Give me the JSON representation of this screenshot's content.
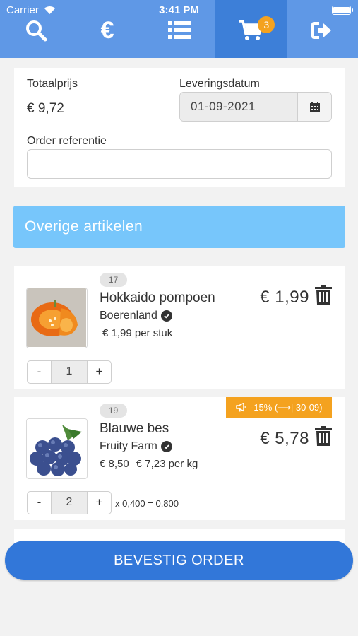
{
  "status_bar": {
    "carrier": "Carrier",
    "time": "3:41 PM"
  },
  "nav": {
    "tabs": [
      {
        "icon": "search-icon",
        "active": false
      },
      {
        "icon": "euro-icon",
        "glyph": "€",
        "active": false
      },
      {
        "icon": "list-icon",
        "active": false
      },
      {
        "icon": "cart-icon",
        "active": true,
        "badge": "3"
      },
      {
        "icon": "logout-icon",
        "active": false
      }
    ]
  },
  "order": {
    "total_label": "Totaalprijs",
    "total_value": "€ 9,72",
    "delivery_label": "Leveringsdatum",
    "delivery_value": "01-09-2021",
    "reference_label": "Order referentie",
    "reference_value": ""
  },
  "section": {
    "title": "Overige artikelen"
  },
  "items": [
    {
      "position": "17",
      "name": "Hokkaido pompoen",
      "brand": "Boerenland",
      "unit_price": "€ 1,99 per stuk",
      "old_price": "",
      "price": "€ 1,99",
      "quantity": "1",
      "calc": "",
      "promo": ""
    },
    {
      "position": "19",
      "name": "Blauwe bes",
      "brand": "Fruity Farm",
      "old_price": "€ 8,50",
      "unit_price": "€ 7,23 per kg",
      "price": "€ 5,78",
      "quantity": "2",
      "calc": "x 0,400 = 0,800",
      "promo": "-15% (⟶| 30-09)"
    }
  ],
  "qty_buttons": {
    "minus": "-",
    "plus": "+"
  },
  "confirm_button": "BEVESTIG ORDER",
  "colors": {
    "nav_bg": "#5f98e6",
    "nav_active": "#3d7fd8",
    "badge": "#f4a21f",
    "section_bar": "#77c6fb",
    "confirm": "#3277d9"
  }
}
